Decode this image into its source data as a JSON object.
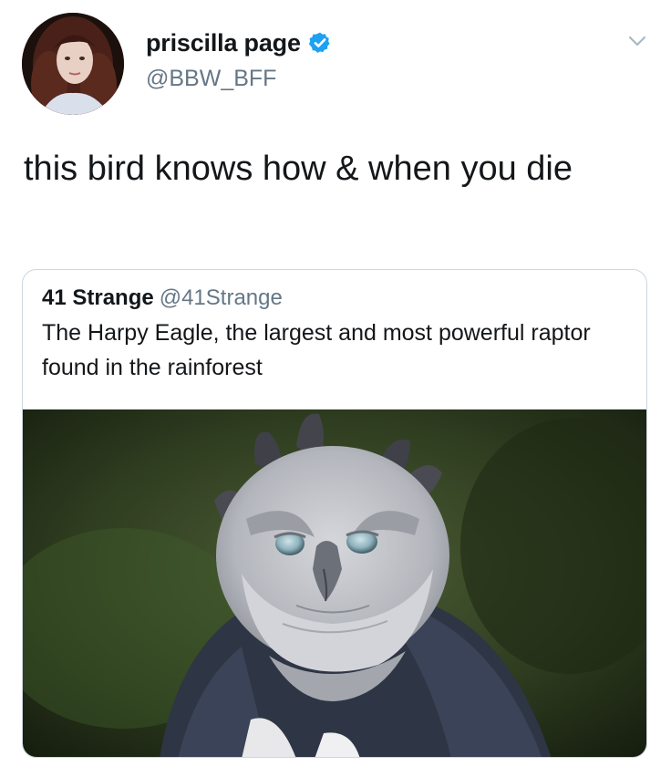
{
  "tweet": {
    "author": {
      "display_name": "priscilla page",
      "handle": "@BBW_BFF",
      "verified": true,
      "avatar": "profile-photo"
    },
    "text": "this bird knows how & when you die",
    "menu_icon": "chevron-down-icon"
  },
  "quoted_tweet": {
    "author_name": "41 Strange",
    "author_handle": "@41Strange",
    "text": "The Harpy Eagle, the largest and most powerful raptor found in the rainforest",
    "media": "harpy-eagle-photo"
  },
  "colors": {
    "primary_text": "#14171a",
    "secondary_text": "#657786",
    "verified_blue": "#1da1f2",
    "card_border": "#ccd6dd"
  }
}
